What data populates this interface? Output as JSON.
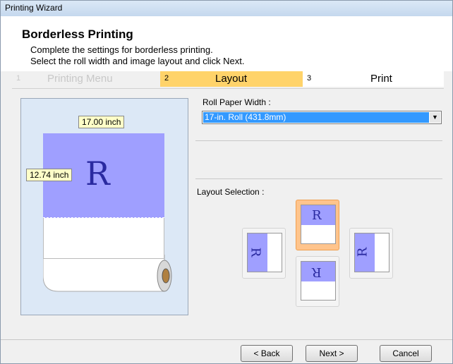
{
  "window": {
    "title": "Printing Wizard"
  },
  "header": {
    "title": "Borderless Printing",
    "line1": "Complete the settings for borderless printing.",
    "line2": "Select the roll width and image layout and click Next."
  },
  "steps": [
    {
      "num": "1",
      "label": "Printing Menu"
    },
    {
      "num": "2",
      "label": "Layout"
    },
    {
      "num": "3",
      "label": "Print"
    }
  ],
  "preview": {
    "width_label": "17.00 inch",
    "height_label": "12.74 inch",
    "letter": "R"
  },
  "roll": {
    "label": "Roll Paper Width :",
    "value": "17-in. Roll (431.8mm)"
  },
  "layout": {
    "label": "Layout Selection :",
    "letter": "R"
  },
  "buttons": {
    "back": "< Back",
    "next": "Next >",
    "cancel": "Cancel"
  },
  "colors": {
    "active_step": "#ffd36a",
    "selected_layout": "#ffc48c",
    "image_area": "#9f9fff"
  }
}
